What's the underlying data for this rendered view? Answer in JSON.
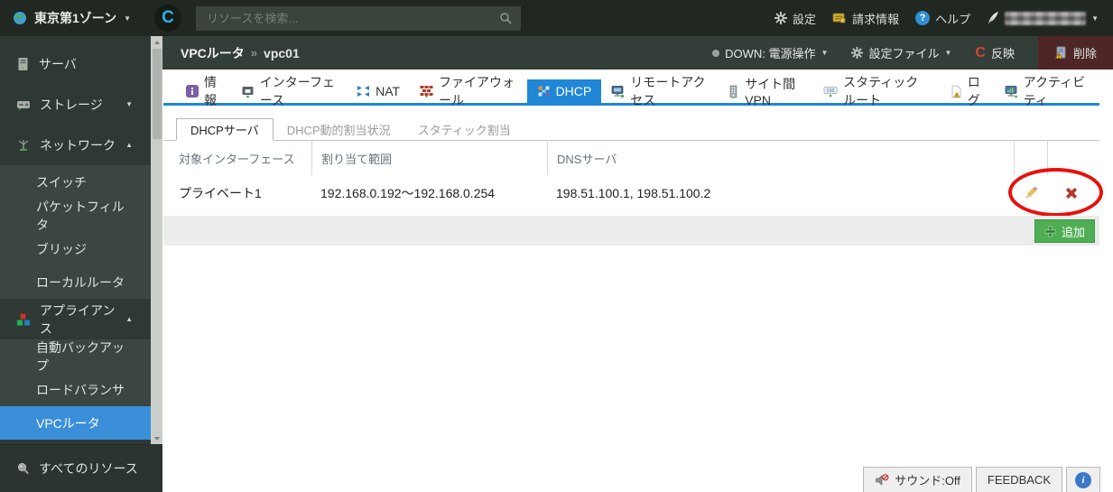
{
  "topbar": {
    "zone_label": "東京第1ゾーン",
    "logo_letter": "C",
    "search_placeholder": "リソースを検索...",
    "settings_label": "設定",
    "billing_label": "請求情報",
    "help_label": "ヘルプ"
  },
  "actionbar": {
    "breadcrumb_parent": "VPCルータ",
    "breadcrumb_sep": "»",
    "breadcrumb_current": "vpc01",
    "power_label": "DOWN: 電源操作",
    "config_label": "設定ファイル",
    "apply_icon_letter": "C",
    "apply_label": "反映",
    "delete_label": "削除"
  },
  "sidebar": {
    "items": [
      {
        "label": "サーバ"
      },
      {
        "label": "ストレージ"
      },
      {
        "label": "ネットワーク"
      },
      {
        "label": "スイッチ"
      },
      {
        "label": "パケットフィルタ"
      },
      {
        "label": "ブリッジ"
      },
      {
        "label": "ローカルルータ"
      },
      {
        "label": "アプライアンス"
      },
      {
        "label": "自動バックアップ"
      },
      {
        "label": "ロードバランサ"
      },
      {
        "label": "VPCルータ",
        "selected": true
      },
      {
        "label": "すべてのリソース"
      }
    ]
  },
  "tabs": [
    {
      "label": "情報"
    },
    {
      "label": "インターフェース"
    },
    {
      "label": "NAT"
    },
    {
      "label": "ファイアウォール"
    },
    {
      "label": "DHCP",
      "active": true
    },
    {
      "label": "リモートアクセス"
    },
    {
      "label": "サイト間VPN"
    },
    {
      "label": "スタティックルート"
    },
    {
      "label": "ログ"
    },
    {
      "label": "アクティビティ"
    }
  ],
  "subtabs": [
    {
      "label": "DHCPサーバ",
      "active": true
    },
    {
      "label": "DHCP動的割当状況"
    },
    {
      "label": "スタティック割当"
    }
  ],
  "dhcp_table": {
    "headers": [
      "対象インターフェース",
      "割り当て範囲",
      "DNSサーバ"
    ],
    "rows": [
      {
        "interface": "プライベート1",
        "range": "192.168.0.192〜192.168.0.254",
        "dns": "198.51.100.1, 198.51.100.2"
      }
    ]
  },
  "add_button_label": "追加",
  "footer": {
    "sound_label": "サウンド:Off",
    "feedback_label": "FEEDBACK",
    "info_label": "i"
  },
  "colors": {
    "selected_blue": "#3b8fd9",
    "active_tab_blue": "#1f87d6",
    "delete_bg": "#4e2628",
    "add_green": "#4fae53",
    "annotation_red": "#e8100c"
  }
}
